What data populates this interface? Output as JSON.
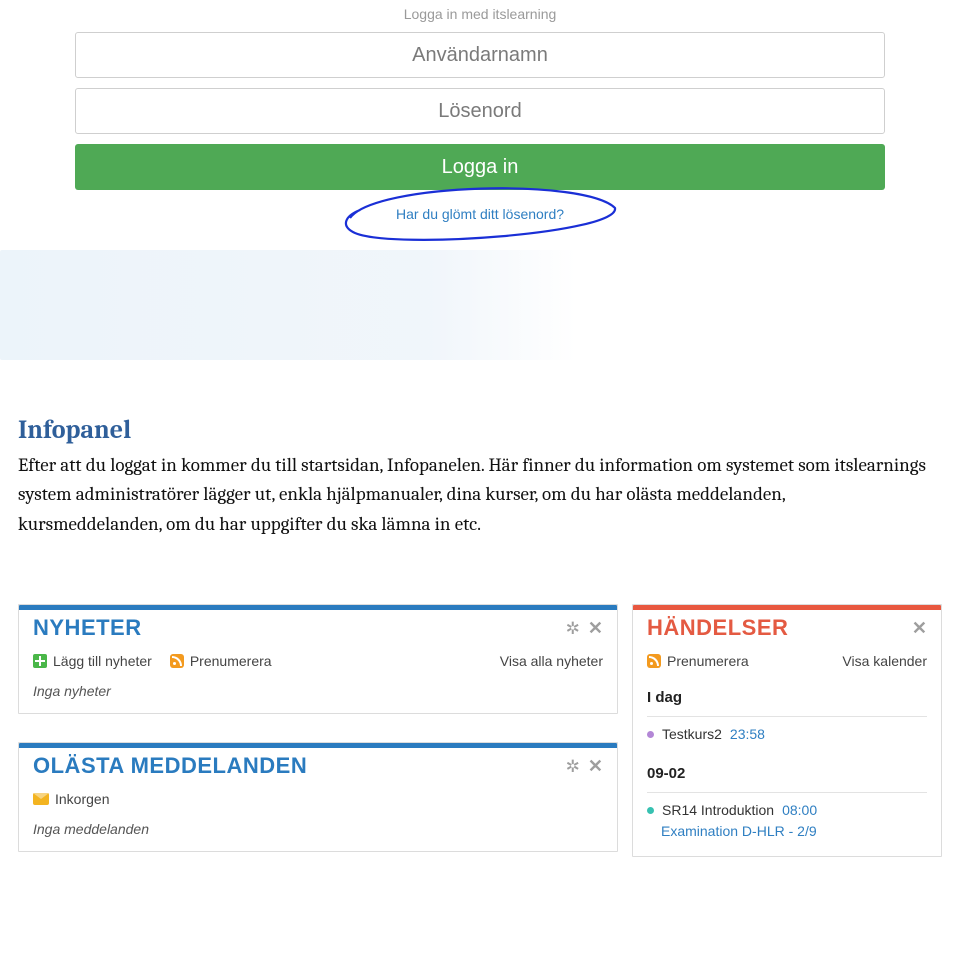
{
  "login": {
    "title": "Logga in med itslearning",
    "username_placeholder": "Användarnamn",
    "password_placeholder": "Lösenord",
    "submit_label": "Logga in",
    "forgot_label": "Har du glömt ditt lösenord?"
  },
  "doc": {
    "heading": "Infopanel",
    "body": "Efter att du loggat in kommer du till startsidan, Infopanelen. Här finner du information om systemet som itslearnings system administratörer lägger ut, enkla hjälpmanualer, dina kurser, om du har olästa meddelanden, kursmeddelanden, om du har uppgifter du ska lämna in etc."
  },
  "panels": {
    "news": {
      "title": "NYHETER",
      "add_label": "Lägg till nyheter",
      "subscribe_label": "Prenumerera",
      "show_all_label": "Visa alla nyheter",
      "empty": "Inga nyheter"
    },
    "unread": {
      "title": "OLÄSTA MEDDELANDEN",
      "inbox_label": "Inkorgen",
      "empty": "Inga meddelanden"
    },
    "events": {
      "title": "HÄNDELSER",
      "subscribe_label": "Prenumerera",
      "show_cal_label": "Visa kalender",
      "groups": [
        {
          "heading": "I dag",
          "items": [
            {
              "dot": "purple",
              "name": "Testkurs2",
              "time": "23:58"
            }
          ]
        },
        {
          "heading": "09-02",
          "items": [
            {
              "dot": "teal",
              "name": "SR14 Introduktion",
              "time": "08:00",
              "sublink": "Examination D-HLR - 2/9"
            }
          ]
        }
      ]
    }
  }
}
